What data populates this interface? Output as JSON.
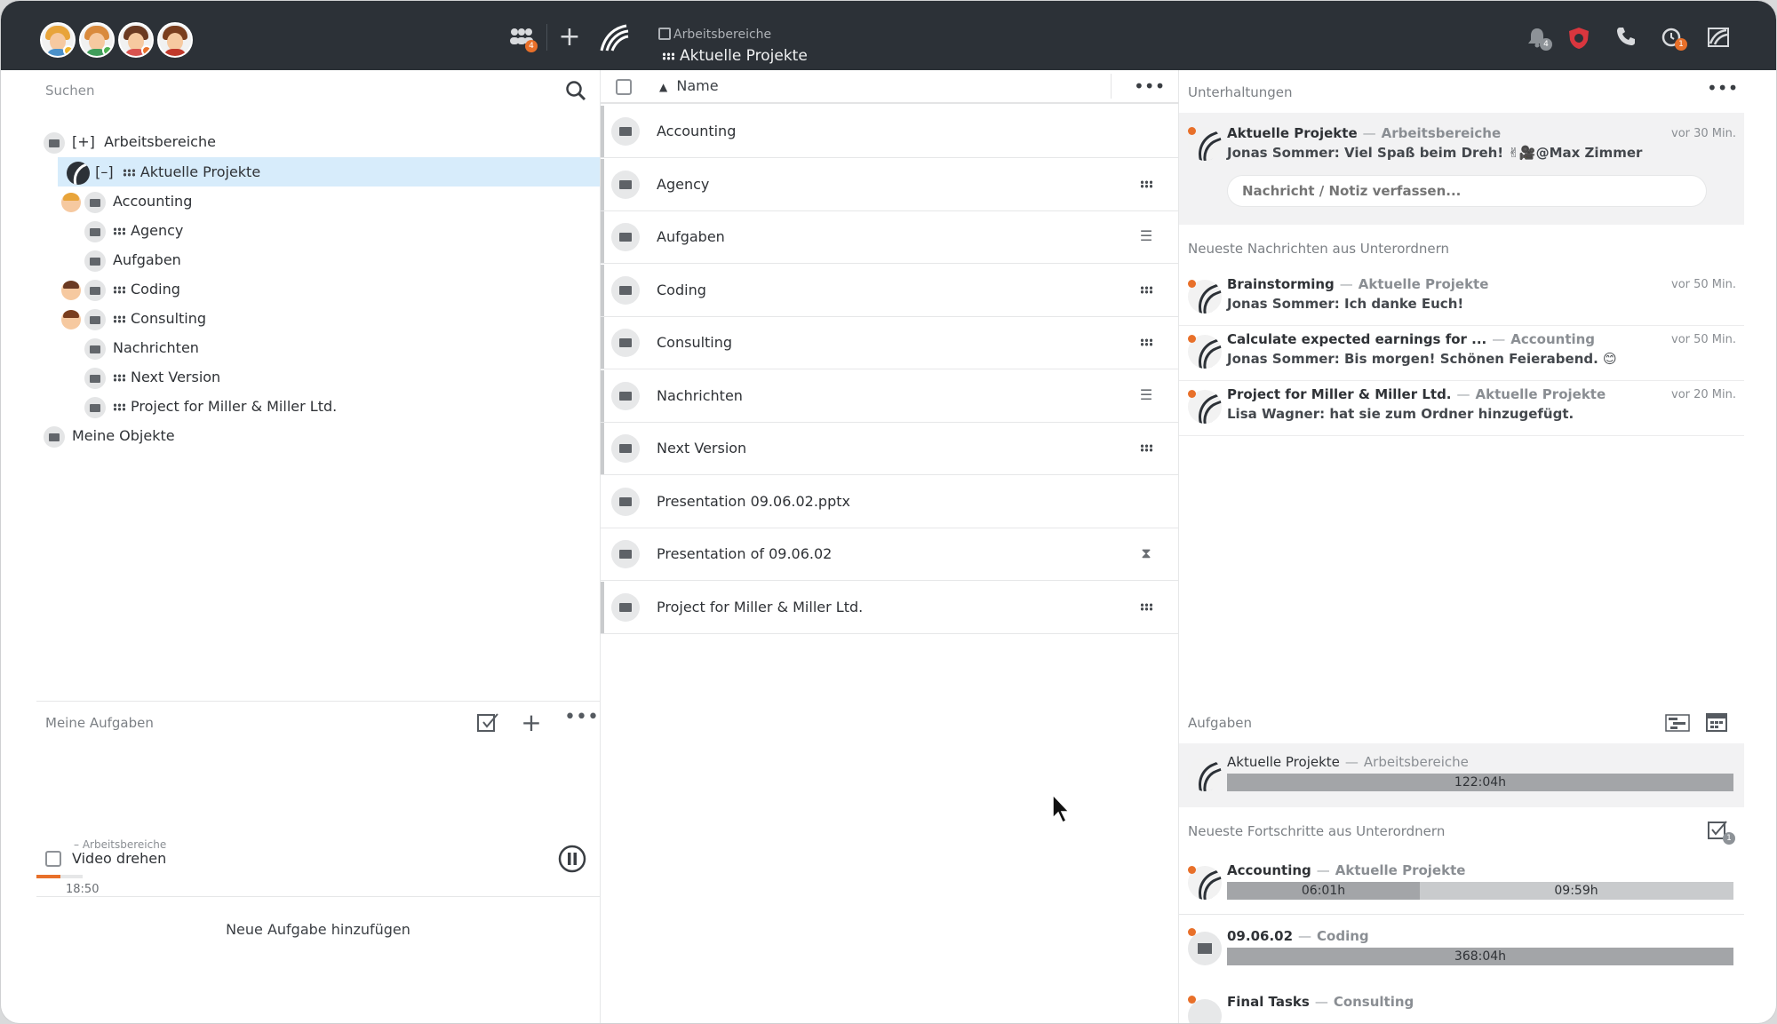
{
  "topbar": {
    "users_badge": "4",
    "crumb_parent": "Arbeitsbereiche",
    "crumb_current": "Aktuelle Projekte",
    "notifications_badge": "4",
    "timer_badge": "1"
  },
  "left": {
    "search_label": "Suchen",
    "tree": {
      "root_toggle": "[+]",
      "root_label": "Arbeitsbereiche",
      "current_toggle": "[–]",
      "current_label": "Aktuelle Projekte",
      "items": [
        "Accounting",
        "Agency",
        "Aufgaben",
        "Coding",
        "Consulting",
        "Nachrichten",
        "Next Version",
        "Project for Miller & Miller Ltd."
      ],
      "my_objects": "Meine Objekte"
    },
    "tasks": {
      "title": "Meine Aufgaben",
      "task_context": "– Arbeitsbereiche",
      "task_name": "Video drehen",
      "task_time": "18:50",
      "task_progress": 0.52,
      "add_label": "Neue Aufgabe hinzufügen"
    }
  },
  "middle": {
    "header_label": "Name",
    "rows": [
      {
        "name": "Accounting",
        "type": ""
      },
      {
        "name": "Agency",
        "type": "grid"
      },
      {
        "name": "Aufgaben",
        "type": "list"
      },
      {
        "name": "Coding",
        "type": "grid"
      },
      {
        "name": "Consulting",
        "type": "grid"
      },
      {
        "name": "Nachrichten",
        "type": "list"
      },
      {
        "name": "Next Version",
        "type": "grid"
      },
      {
        "name": "Presentation 09.06.02.pptx",
        "type": ""
      },
      {
        "name": "Presentation of 09.06.02",
        "type": "hourglass"
      },
      {
        "name": "Project for Miller & Miller Ltd.",
        "type": "grid"
      }
    ]
  },
  "right": {
    "conversations_title": "Unterhaltungen",
    "pinned": {
      "title": "Aktuelle Projekte",
      "where": "Arbeitsbereiche",
      "message": "Jonas Sommer: Viel Spaß beim Dreh! ✌🎥@Max Zimmer",
      "time": "vor 30 Min.",
      "input_placeholder": "Nachricht / Notiz verfassen..."
    },
    "recent_title": "Neueste Nachrichten aus Unterordnern",
    "recent": [
      {
        "title": "Brainstorming",
        "where": "Aktuelle Projekte",
        "message": "Jonas Sommer: Ich danke Euch!",
        "time": "vor 50 Min."
      },
      {
        "title": "Calculate expected earnings for ...",
        "where": "Accounting",
        "message": "Jonas Sommer: Bis morgen! Schönen Feierabend. 😊",
        "time": "vor 50 Min."
      },
      {
        "title": "Project for Miller & Miller Ltd.",
        "where": "Aktuelle Projekte",
        "message": "Lisa Wagner: hat sie zum Ordner hinzugefügt.",
        "time": "vor 20 Min."
      }
    ],
    "tasks_title": "Aufgaben",
    "task_main": {
      "title": "Aktuelle Projekte",
      "where": "Arbeitsbereiche",
      "time": "122:04h"
    },
    "progress_title": "Neueste Fortschritte aus Unterordnern",
    "progress_badge": "1",
    "progress": [
      {
        "title": "Accounting",
        "where": "Aktuelle Projekte",
        "done": "06:01h",
        "total": "09:59h",
        "fraction": 0.38
      },
      {
        "title": "09.06.02",
        "where": "Coding",
        "total": "368:04h"
      },
      {
        "title": "Final Tasks",
        "where": "Consulting"
      }
    ]
  },
  "colors": {
    "topbar": "#2c3137",
    "accent": "#e8702a",
    "selection": "#d7ecfb"
  }
}
